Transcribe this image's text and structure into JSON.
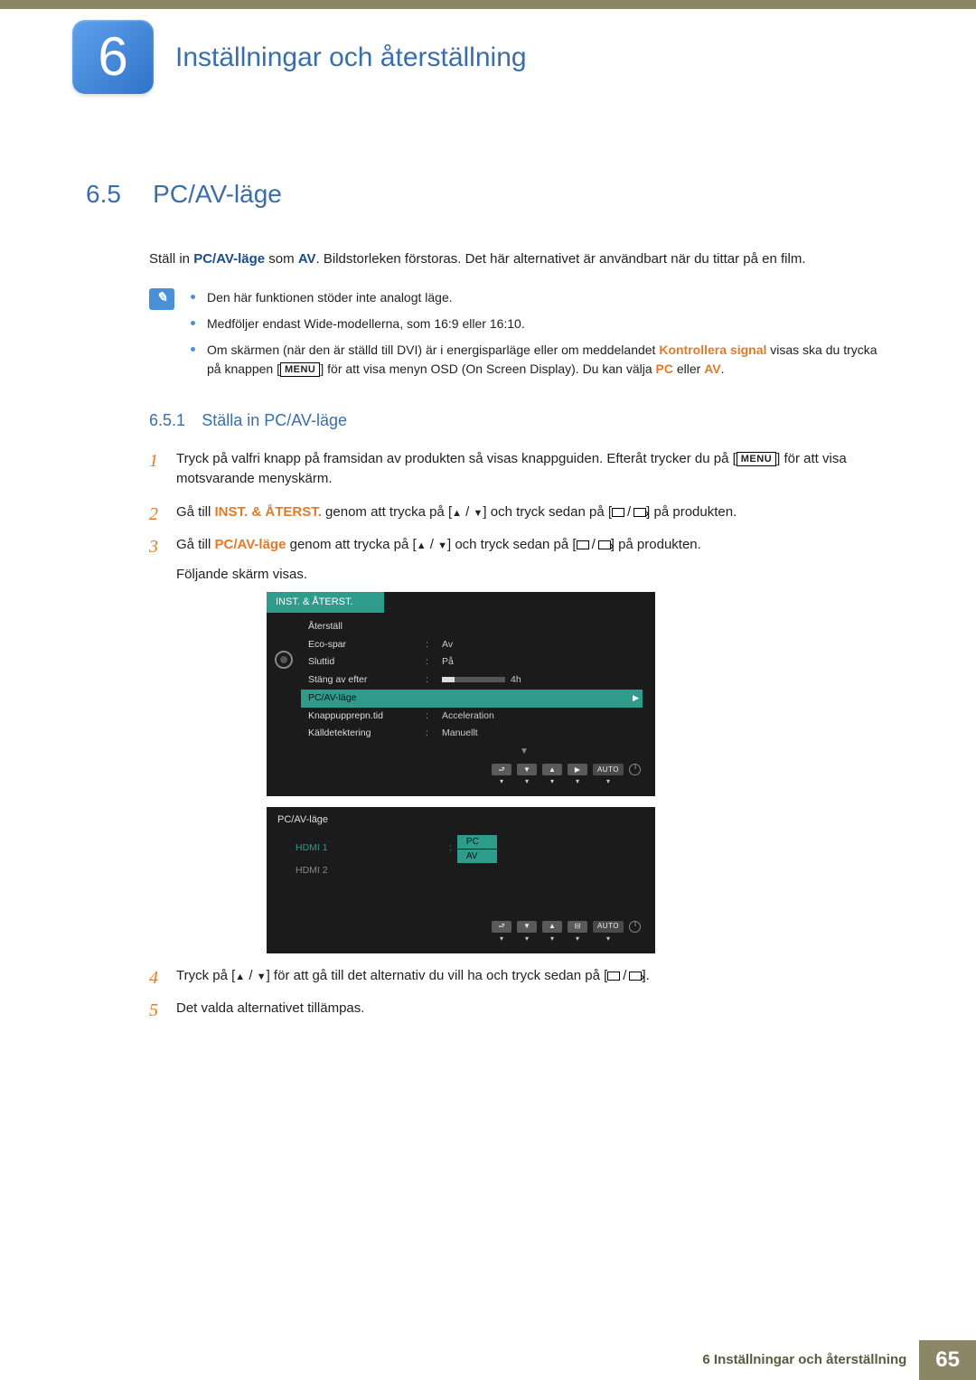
{
  "chapter": {
    "number": "6",
    "title": "Inställningar och återställning"
  },
  "section": {
    "number": "6.5",
    "title": "PC/AV-läge"
  },
  "intro": {
    "pre": "Ställ in ",
    "bold1": "PC/AV-läge",
    "mid": " som ",
    "bold2": "AV",
    "post": ". Bildstorleken förstoras. Det här alternativet är användbart när du tittar på en film."
  },
  "notes": {
    "n1": "Den här funktionen stöder inte analogt läge.",
    "n2": "Medföljer endast Wide-modellerna, som 16:9 eller 16:10.",
    "n3_pre": "Om skärmen (när den är ställd till DVI) är i energisparläge eller om meddelandet ",
    "n3_orange": "Kontrollera signal",
    "n3_mid": " visas ska du trycka på knappen [",
    "n3_menu": "MENU",
    "n3_post": "] för att visa menyn OSD (On Screen Display). Du kan välja ",
    "n3_pc": "PC",
    "n3_or": " eller ",
    "n3_av": "AV",
    "n3_end": "."
  },
  "subsection": {
    "number": "6.5.1",
    "title": "Ställa in PC/AV-läge"
  },
  "steps": {
    "s1a": "Tryck på valfri knapp på framsidan av produkten så visas knappguiden. Efteråt trycker du på [",
    "s1menu": "MENU",
    "s1b": "] för att visa motsvarande menyskärm.",
    "s2a": "Gå till ",
    "s2orange": "INST. & ÅTERST.",
    "s2b": " genom att trycka på [",
    "s2c": "] och tryck sedan på [",
    "s2d": "] på produkten.",
    "s3a": "Gå till ",
    "s3orange": "PC/AV-läge",
    "s3b": " genom att trycka på [",
    "s3c": "] och tryck sedan på [",
    "s3d": "] på produkten.",
    "s3e": "Följande skärm visas.",
    "s4a": "Tryck på [",
    "s4b": "] för att gå till det alternativ du vill ha och tryck sedan på [",
    "s4c": "].",
    "s5": "Det valda alternativet tillämpas."
  },
  "osd1": {
    "title": "INST. & ÅTERST.",
    "rows": [
      {
        "label": "Återställ",
        "value": ""
      },
      {
        "label": "Eco-spar",
        "value": "Av"
      },
      {
        "label": "Sluttid",
        "value": "På"
      },
      {
        "label": "Stäng av efter",
        "value": "4h",
        "bar": true
      },
      {
        "label": "PC/AV-läge",
        "value": "",
        "selected": true
      },
      {
        "label": "Knappupprepn.tid",
        "value": "Acceleration"
      },
      {
        "label": "Källdetektering",
        "value": "Manuellt"
      }
    ],
    "auto": "AUTO"
  },
  "osd2": {
    "title": "PC/AV-läge",
    "rows": [
      {
        "label": "HDMI 1",
        "pc": "PC",
        "av": "AV",
        "active": true
      },
      {
        "label": "HDMI 2"
      }
    ],
    "auto": "AUTO"
  },
  "footer": {
    "text": "6 Inställningar och återställning",
    "page": "65"
  }
}
